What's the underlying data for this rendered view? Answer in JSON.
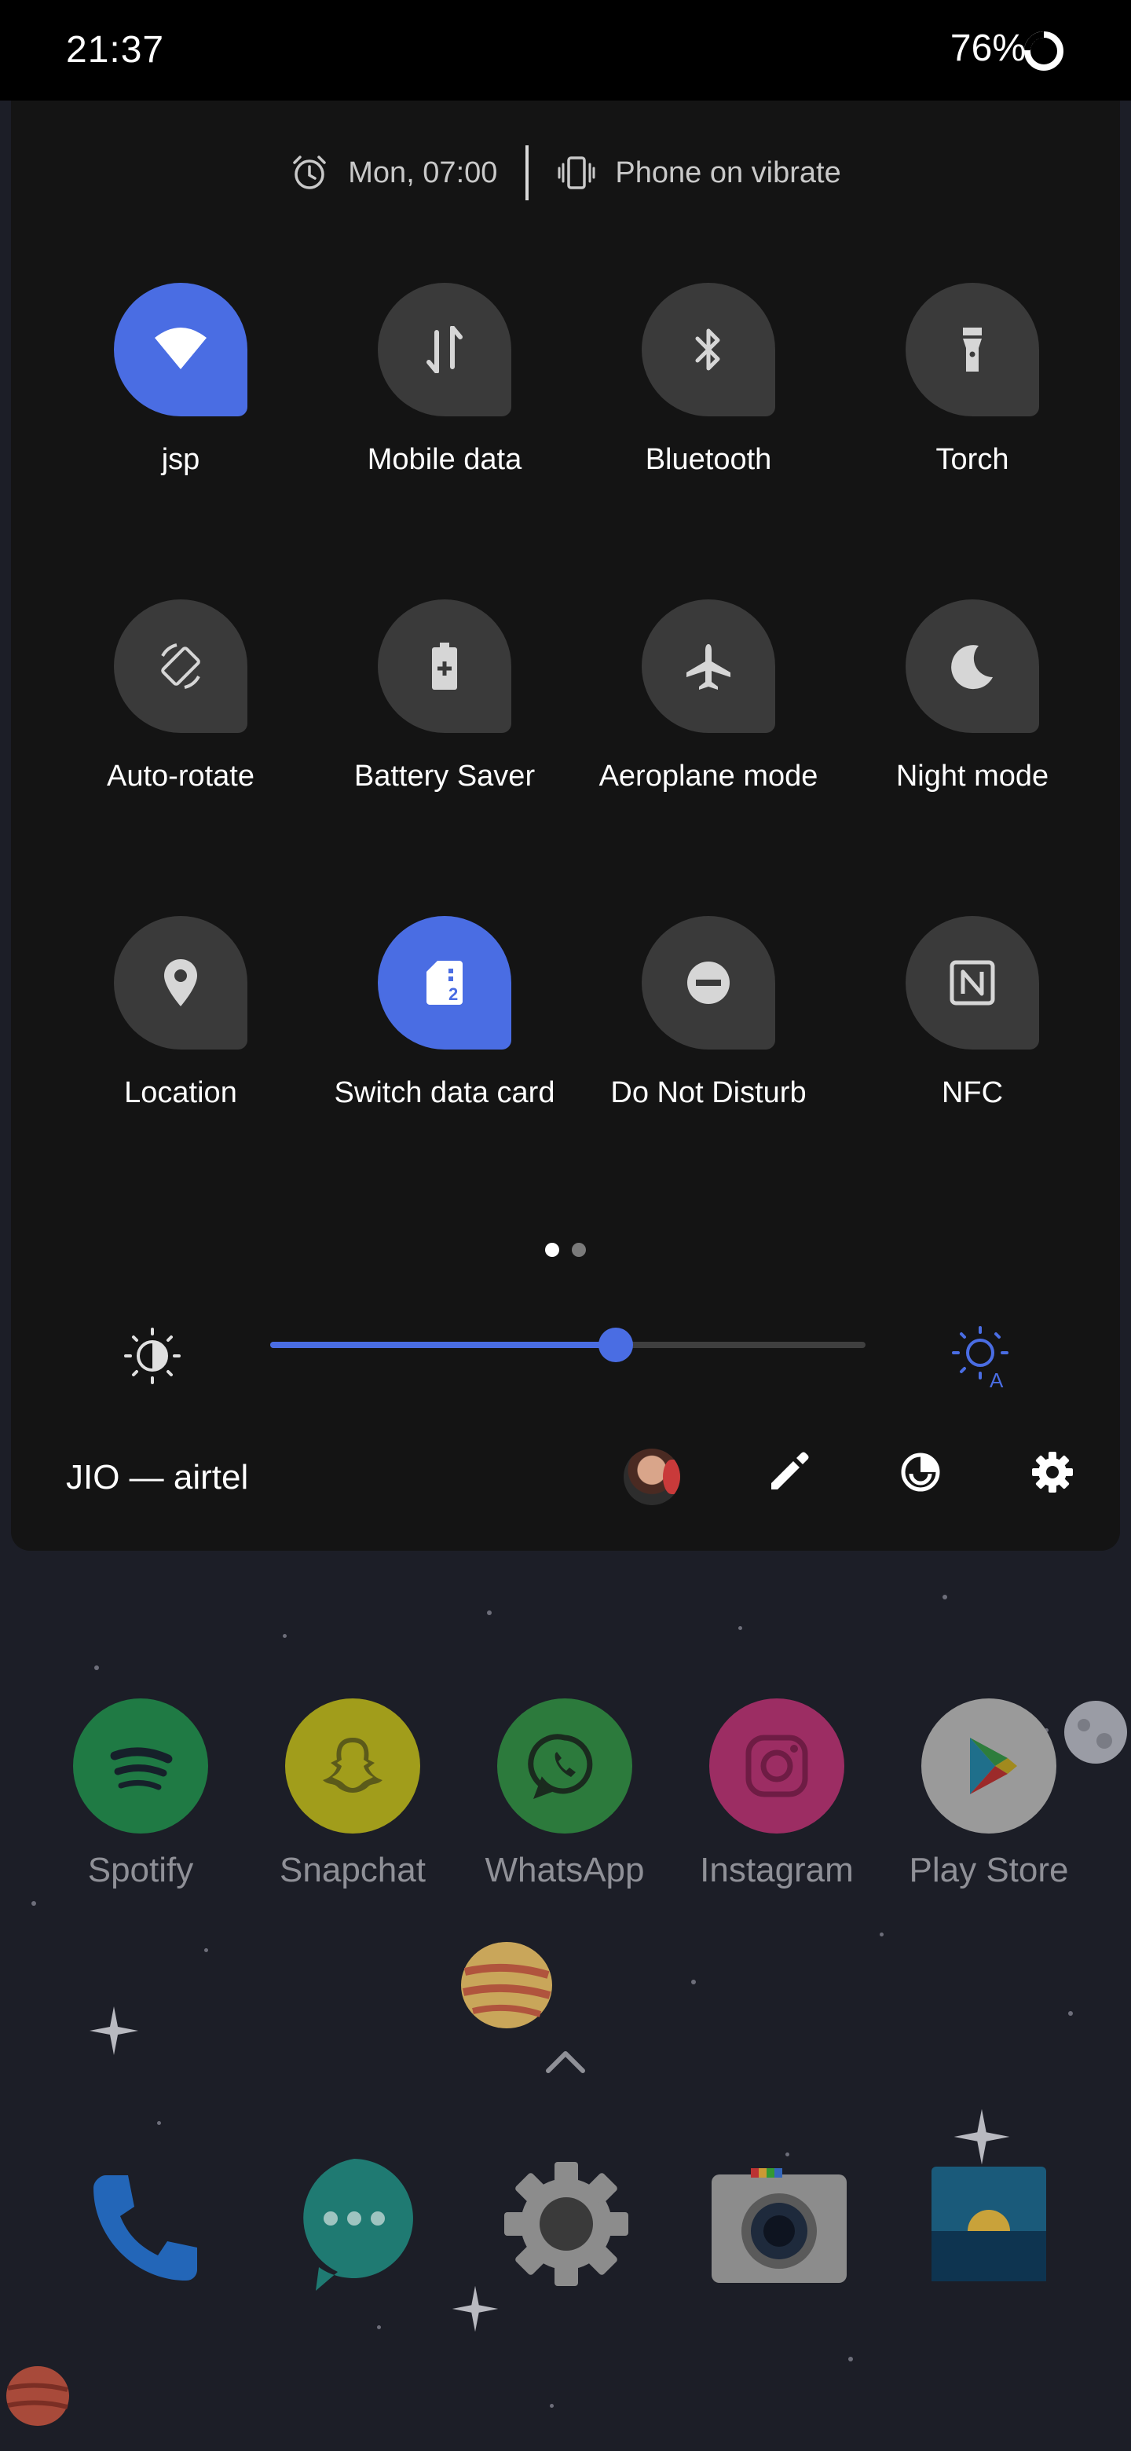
{
  "status_bar": {
    "time": "21:37",
    "battery": "76%"
  },
  "quick_settings": {
    "header": {
      "alarm": "Mon, 07:00",
      "ringer": "Phone on vibrate"
    },
    "tiles": [
      {
        "label": "jsp",
        "icon": "wifi-icon",
        "active": true
      },
      {
        "label": "Mobile data",
        "icon": "mobile-data-icon",
        "active": false
      },
      {
        "label": "Bluetooth",
        "icon": "bluetooth-icon",
        "active": false
      },
      {
        "label": "Torch",
        "icon": "torch-icon",
        "active": false
      },
      {
        "label": "Auto-rotate",
        "icon": "auto-rotate-icon",
        "active": false
      },
      {
        "label": "Battery Saver",
        "icon": "battery-saver-icon",
        "active": false
      },
      {
        "label": "Aeroplane mode",
        "icon": "aeroplane-icon",
        "active": false
      },
      {
        "label": "Night mode",
        "icon": "night-mode-icon",
        "active": false
      },
      {
        "label": "Location",
        "icon": "location-icon",
        "active": false
      },
      {
        "label": "Switch data card",
        "icon": "sim-card-icon",
        "active": true
      },
      {
        "label": "Do Not Disturb",
        "icon": "do-not-disturb-icon",
        "active": false
      },
      {
        "label": "NFC",
        "icon": "nfc-icon",
        "active": false
      }
    ],
    "page_count": 2,
    "current_page": 1,
    "brightness_level": 0.58,
    "carrier": "JIO — airtel",
    "accent_color": "#4a6de3"
  },
  "home_apps": [
    {
      "label": "Spotify",
      "icon": "spotify-icon",
      "color": "#1f7a44"
    },
    {
      "label": "Snapchat",
      "icon": "snapchat-icon",
      "color": "#a19d1b"
    },
    {
      "label": "WhatsApp",
      "icon": "whatsapp-icon",
      "color": "#2c7a3c"
    },
    {
      "label": "Instagram",
      "icon": "instagram-icon",
      "color": "#9c2d63"
    },
    {
      "label": "Play Store",
      "icon": "play-store-icon",
      "color": "#9a9a9a"
    }
  ],
  "dock": [
    {
      "icon": "phone-icon"
    },
    {
      "icon": "messages-icon"
    },
    {
      "icon": "settings-icon"
    },
    {
      "icon": "camera-icon"
    },
    {
      "icon": "gallery-icon"
    }
  ]
}
